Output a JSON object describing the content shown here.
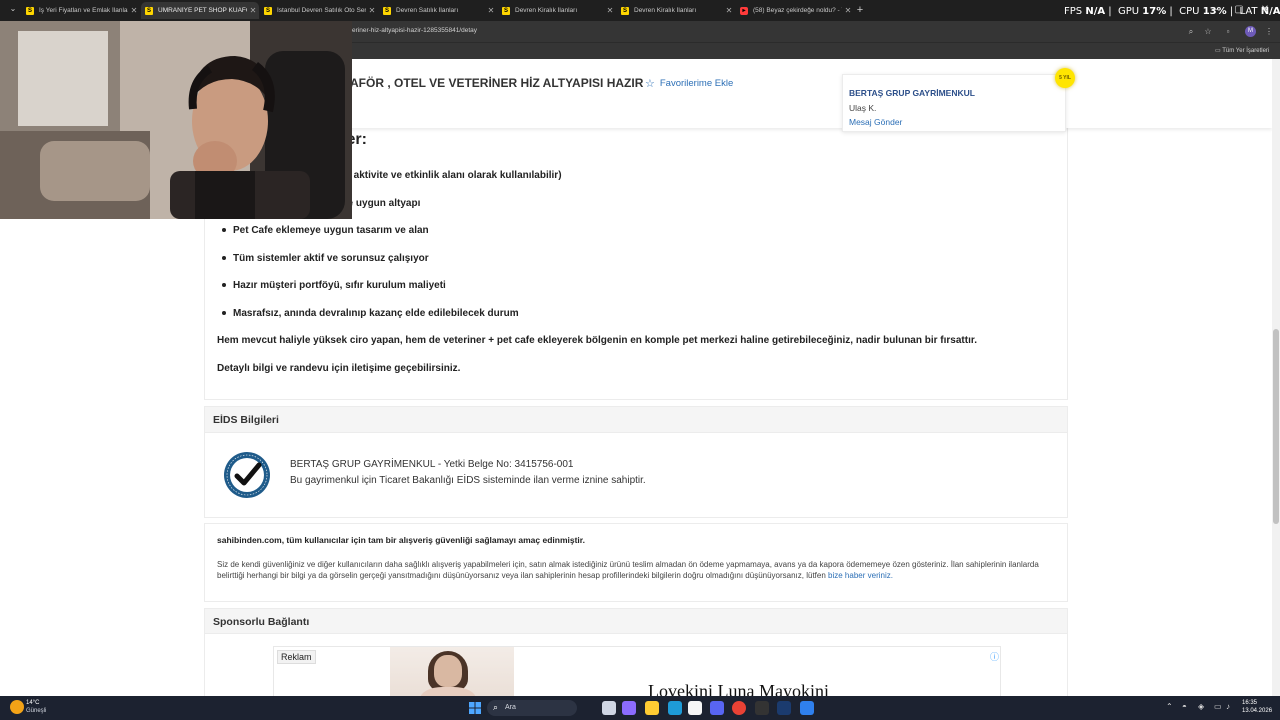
{
  "browser": {
    "tabs": [
      {
        "title": "İş Yeri Fiyatları ve Emlak İlanları",
        "active": false,
        "icon": "sahibinden-favicon"
      },
      {
        "title": "ÜMRANİYE PET SHOP KUAFÖR",
        "active": true,
        "icon": "sahibinden-favicon"
      },
      {
        "title": "İstanbul Devren Satılık Oto Serv",
        "active": false,
        "icon": "sahibinden-favicon"
      },
      {
        "title": "Devren Satılık İlanları",
        "active": false,
        "icon": "sahibinden-favicon"
      },
      {
        "title": "Devren Kiralık İlanları",
        "active": false,
        "icon": "sahibinden-favicon"
      },
      {
        "title": "Devren Kiralık İlanları",
        "active": false,
        "icon": "sahibinden-favicon"
      },
      {
        "title": "(58) Beyaz çekirdeğe noldu? - Y",
        "active": false,
        "icon": "youtube-favicon"
      }
    ],
    "url": "eriner-hiz-altyapisi-hazir-1285355841/detay",
    "bookmarks_all": "Tüm Yer İşaretleri",
    "profile_initial": "M"
  },
  "overlay": {
    "fps_label": "FPS",
    "fps_value": "N/A",
    "gpu_label": "GPU",
    "gpu_value": "17",
    "cpu_label": "CPU",
    "cpu_value": "13",
    "lat_label": "LAT",
    "lat_value": "N/A",
    "percent": "%"
  },
  "listing": {
    "title": "AFÖR , OTEL VE VETERİNER HİZ ALTYAPISI HAZIR",
    "favorite_label": "Favorilerime Ekle",
    "sub_cut": "e"
  },
  "seller": {
    "company": "BERTAŞ GRUP GAYRİMENKUL",
    "person": "Ulaş K.",
    "message_link": "Mesaj Gönder",
    "badge": "5 YIL"
  },
  "description": {
    "heading": "ler:",
    "items": [
      "n, aktivite ve etkinlik alanı olarak kullanılabilir)",
      "ye uygun altyapı",
      "Pet Cafe eklemeye uygun tasarım ve alan",
      "Tüm sistemler aktif ve sorunsuz çalışıyor",
      "Hazır müşteri portföyü, sıfır kurulum maliyeti",
      "Masrafsız, anında devralınıp kazanç elde edilebilecek durum"
    ],
    "para1": "Hem mevcut haliyle yüksek ciro yapan, hem de veteriner + pet cafe ekleyerek bölgenin en komple pet merkezi haline getirebileceğiniz, nadir bulunan bir fırsattır.",
    "para2": "Detaylı bilgi ve randevu için iletişime geçebilirsiniz."
  },
  "eids": {
    "header": "EİDS Bilgileri",
    "line1": "BERTAŞ GRUP GAYRİMENKUL - Yetki Belge No: 3415756-001",
    "line2": "Bu gayrimenkul için Ticaret Bakanlığı EİDS sisteminde ilan verme iznine sahiptir.",
    "seal_icon": "verified-checkmark-seal-icon"
  },
  "safety": {
    "title": "sahibinden.com, tüm kullanıcılar için tam bir alışveriş güvenliği sağlamayı amaç edinmiştir.",
    "body": "Siz de kendi güvenliğiniz ve diğer kullanıcıların daha sağlıklı alışveriş yapabilmeleri için, satın almak istediğiniz ürünü teslim almadan ön ödeme yapmamaya, avans ya da kapora ödememeye özen gösteriniz. İlan sahiplerinin ilanlarda belirttiği herhangi bir bilgi ya da görselin gerçeği yansıtmadığını düşünüyorsanız veya ilan sahiplerinin hesap profillerindeki bilgilerin doğru olmadığını düşünüyorsanız, lütfen",
    "link": "bize haber veriniz."
  },
  "sponsor": {
    "header": "Sponsorlu Bağlantı",
    "ad_label": "Reklam",
    "ad_text": "Loveķini Luna Mayokini",
    "ad_info_icon": "ⓘ"
  },
  "taskbar": {
    "temp": "14°C",
    "weather": "Güneşli",
    "search_placeholder": "Ara",
    "time": "16:35",
    "date": "13.04.2026"
  },
  "colors": {
    "link": "#2c6fb6",
    "seller_name": "#2c4f8a",
    "badge": "#ffe500",
    "chrome_dark": "#1f1f1f",
    "taskbar": "#1c2230"
  }
}
